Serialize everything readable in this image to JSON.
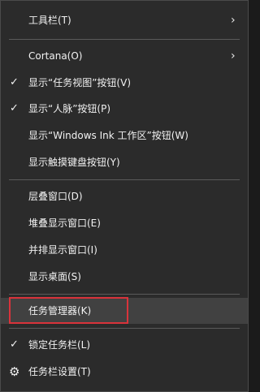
{
  "menu": {
    "items": [
      {
        "label": "工具栏(T)",
        "checked": false,
        "submenu": true
      },
      {
        "label": "Cortana(O)",
        "checked": false,
        "submenu": true
      },
      {
        "label": "显示“任务视图”按钮(V)",
        "checked": true
      },
      {
        "label": "显示“人脉”按钮(P)",
        "checked": true
      },
      {
        "label": "显示“Windows Ink 工作区”按钮(W)",
        "checked": false
      },
      {
        "label": "显示触摸键盘按钮(Y)",
        "checked": false
      },
      {
        "label": "层叠窗口(D)",
        "checked": false
      },
      {
        "label": "堆叠显示窗口(E)",
        "checked": false
      },
      {
        "label": "并排显示窗口(I)",
        "checked": false
      },
      {
        "label": "显示桌面(S)",
        "checked": false
      },
      {
        "label": "任务管理器(K)",
        "checked": false,
        "hovered": true,
        "highlighted": true
      },
      {
        "label": "锁定任务栏(L)",
        "checked": true
      },
      {
        "label": "任务栏设置(T)",
        "checked": false,
        "icon": "gear-icon"
      }
    ],
    "highlight_color": "#d9333b",
    "background": "#2b2b2b",
    "hover_background": "#414141"
  }
}
